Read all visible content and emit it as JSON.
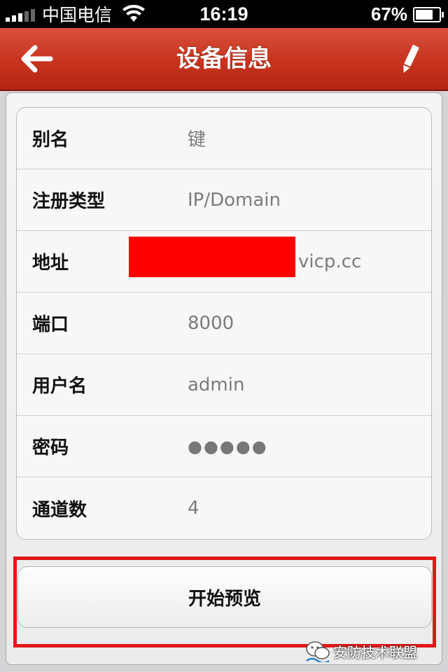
{
  "status_bar": {
    "carrier": "中国电信",
    "time": "16:19",
    "battery": "67%",
    "signal_bars": 3,
    "signal_total": 5
  },
  "nav": {
    "title": "设备信息",
    "back_icon": "arrow-left-icon",
    "edit_icon": "pencil-icon"
  },
  "device_info": [
    {
      "label": "别名",
      "value": "键"
    },
    {
      "label": "注册类型",
      "value": "IP/Domain"
    },
    {
      "label": "地址",
      "value": "vicp.cc"
    },
    {
      "label": "端口",
      "value": "8000"
    },
    {
      "label": "用户名",
      "value": "admin"
    },
    {
      "label": "密码",
      "value": "●●●●●"
    },
    {
      "label": "通道数",
      "value": "4"
    }
  ],
  "preview_button": {
    "label": "开始预览"
  },
  "watermark": {
    "text": "安防技术联盟"
  },
  "colors": {
    "nav_bar": "#c93520",
    "highlight": "#e01818",
    "redaction": "#ff0000"
  }
}
